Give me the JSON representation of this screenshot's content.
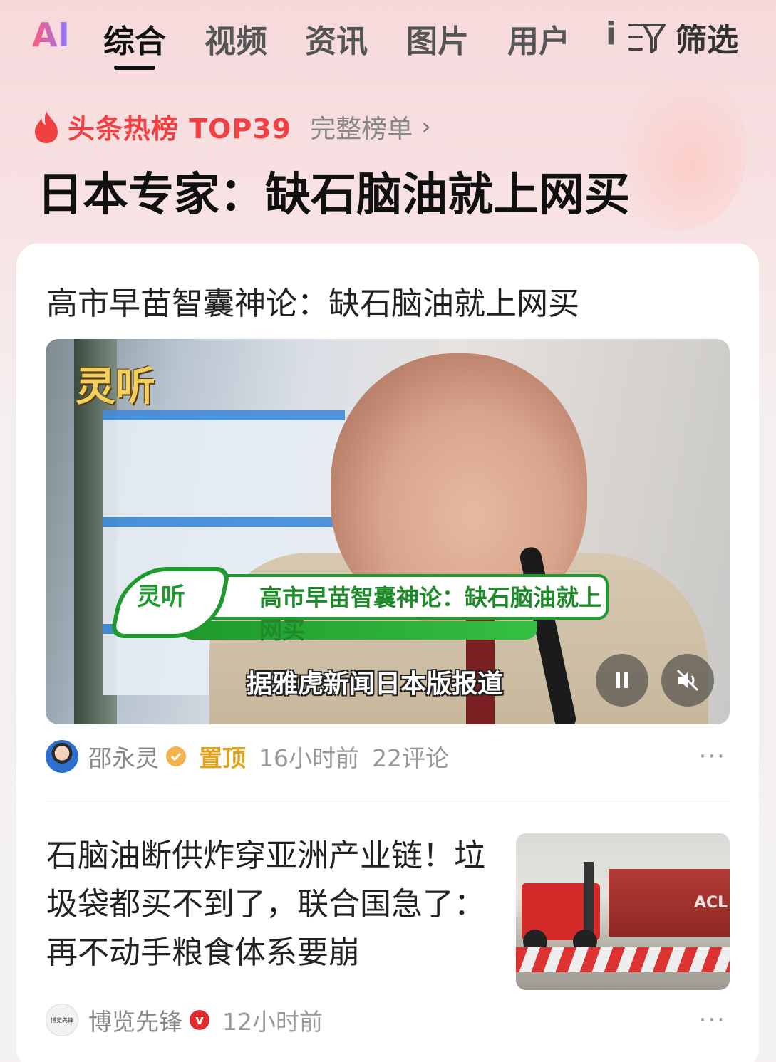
{
  "tabs": {
    "ai_logo": "AI",
    "items": [
      "综合",
      "视频",
      "资讯",
      "图片",
      "用户"
    ],
    "clipped": "i",
    "filter_label": "筛选",
    "filter_icon": "filter-icon"
  },
  "hot": {
    "title": "头条热榜 TOP39",
    "link": "完整榜单",
    "chevron": "›",
    "headline": "日本专家：缺石脑油就上网买",
    "icon": "flame-icon",
    "color": "#f04142"
  },
  "post1": {
    "title": "高市早苗智囊神论：缺石脑油就上网买",
    "video": {
      "channel_logo": "灵听",
      "badge": "灵听",
      "banner_text": "高市早苗智囊神论：缺石脑油就上网买",
      "subtitle": "据雅虎新闻日本版报道",
      "pause_icon": "pause-icon",
      "mute_icon": "mute-icon"
    },
    "author": "邵永灵",
    "pinned": "置顶",
    "time": "16小时前",
    "comments": "22评论",
    "more": "···"
  },
  "post2": {
    "title": "石脑油断供炸穿亚洲产业链！垃圾袋都买不到了，联合国急了：再不动手粮食体系要崩",
    "author": "博览先锋",
    "avatar_text": "博览先锋",
    "verified_mark": "v",
    "time": "12小时前",
    "thumb_text": "ACL",
    "more": "···"
  }
}
